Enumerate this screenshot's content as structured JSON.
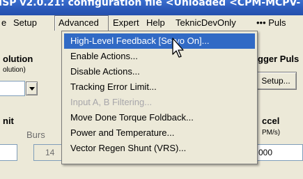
{
  "window": {
    "title": "ISP v2.0.21: configuration file <Unloaded <CPM-MCPV-"
  },
  "menubar": {
    "items": [
      {
        "label": "e"
      },
      {
        "label": "Setup"
      },
      {
        "label": "Advanced"
      },
      {
        "label": "Expert"
      },
      {
        "label": "Help"
      },
      {
        "label": "TeknicDevOnly"
      },
      {
        "label": "••• Puls"
      }
    ]
  },
  "background": {
    "resolution_heading": "olution",
    "resolution_sub": "olution)",
    "trigger_heading": "gger Puls",
    "setup_button": "Setup...",
    "unit_heading": "nit",
    "burst_label": "Burs",
    "burst_value": "14",
    "accel_heading": "ccel",
    "accel_sub": "PM/s)",
    "accel_value": "000"
  },
  "advanced_menu": {
    "items": [
      {
        "label": "High-Level Feedback [Servo On]...",
        "state": "highlighted"
      },
      {
        "label": "Enable Actions...",
        "state": "normal"
      },
      {
        "label": "Disable Actions...",
        "state": "normal"
      },
      {
        "label": "Tracking Error Limit...",
        "state": "normal"
      },
      {
        "label": "Input A, B Filtering...",
        "state": "disabled"
      },
      {
        "label": "Move Done Torque Foldback...",
        "state": "normal"
      },
      {
        "label": "Power and Temperature...",
        "state": "normal"
      },
      {
        "label": "Vector Regen Shunt (VRS)...",
        "state": "normal"
      }
    ]
  },
  "colors": {
    "title_bar": "#2a58b8",
    "menu_highlight": "#316ac5",
    "face": "#ece9d8",
    "disabled_text": "#a7a6aa"
  }
}
